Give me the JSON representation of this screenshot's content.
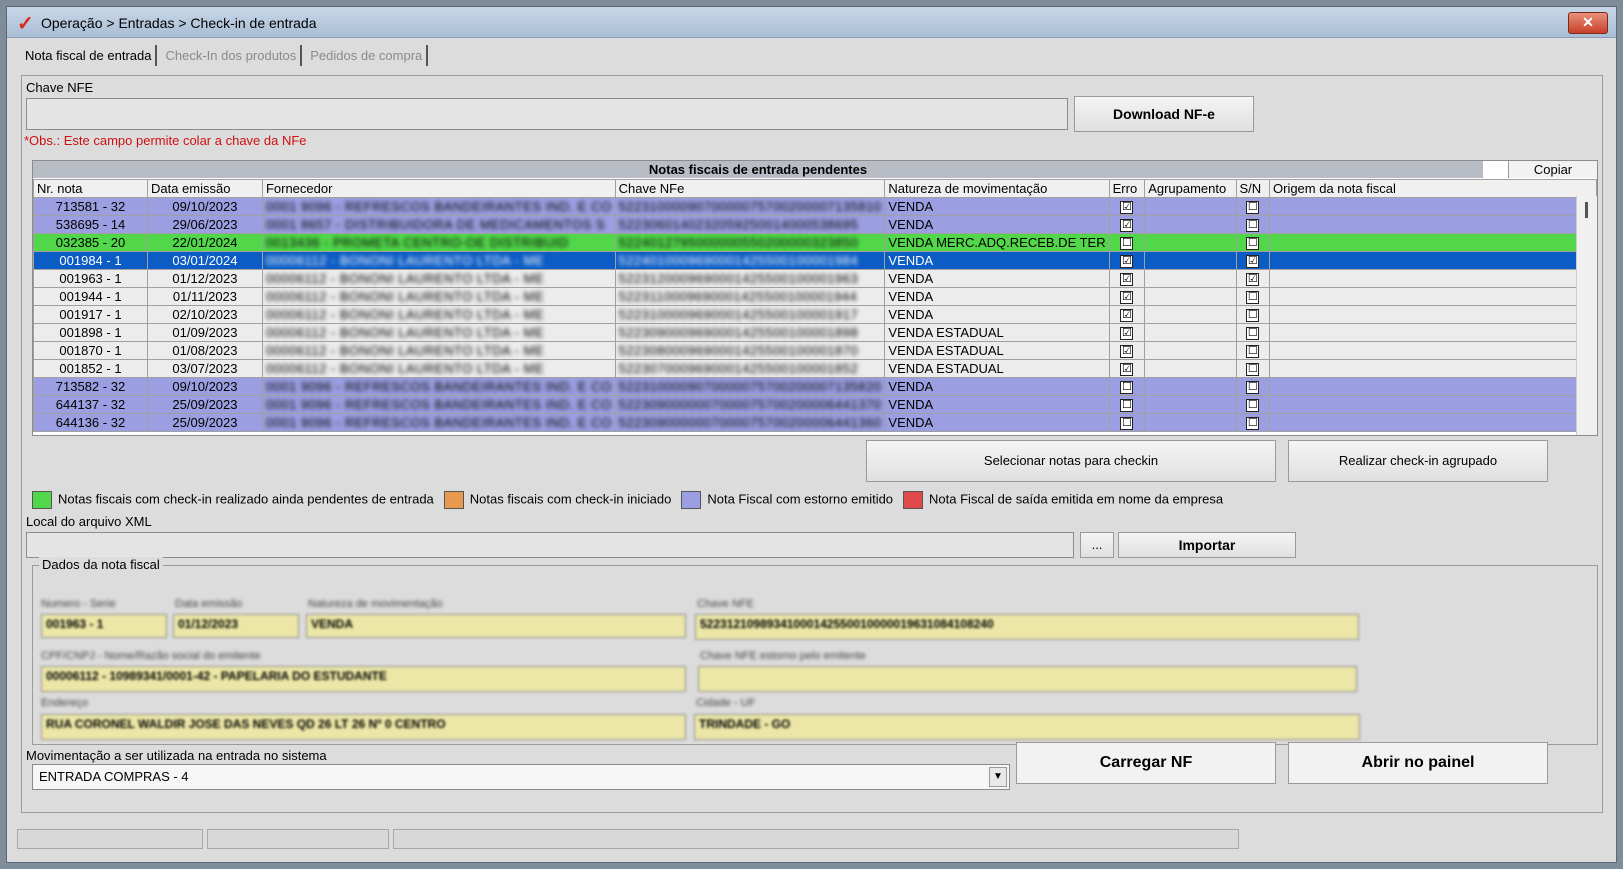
{
  "window": {
    "title": "Operação > Entradas > Check-in de entrada",
    "close_glyph": "✕"
  },
  "tabs": [
    {
      "label": "Nota fiscal de entrada"
    },
    {
      "label": "Check-In dos produtos"
    },
    {
      "label": "Pedidos de compra"
    }
  ],
  "chave": {
    "label": "Chave NFE",
    "value": "",
    "download_label": "Download NF-e",
    "note": "*Obs.: Este campo permite colar a chave da NFe",
    "note_color": "#d01010"
  },
  "grid": {
    "title": "Notas fiscais de entrada pendentes",
    "copy_label": "Copiar",
    "columns": [
      "Nr. nota",
      "Data emissão",
      "Fornecedor",
      "Chave NFe",
      "Natureza de movimentação",
      "Erro",
      "Agrupamento",
      "S/N",
      "Origem da nota fiscal"
    ],
    "rows": [
      {
        "nr": "713581 - 32",
        "data": "09/10/2023",
        "fornecedor": "0001 9096 - REFRESCOS BANDEIRANTES IND. E CO",
        "chave": "5223100009070000075700200007135810",
        "natureza": "VENDA",
        "erro": "☑",
        "agrup": "",
        "sn": "☐",
        "origem": "",
        "style": "lav"
      },
      {
        "nr": "538695 - 14",
        "data": "29/06/2023",
        "fornecedor": "0001 8657 - DISTRIBUIDORA DE MEDICAMENTOS S",
        "chave": "5223060140232059250014000538695",
        "natureza": "VENDA",
        "erro": "☑",
        "agrup": "",
        "sn": "☐",
        "origem": "",
        "style": "lav"
      },
      {
        "nr": "032385 - 20",
        "data": "22/01/2024",
        "fornecedor": "0013436 - PROMETA CENTRO-OE DISTRIBUID",
        "chave": "5224012795000000550200000323850",
        "natureza": "VENDA MERC.ADQ.RECEB.DE TER",
        "erro": "☐",
        "agrup": "",
        "sn": "☐",
        "origem": "",
        "style": "green"
      },
      {
        "nr": "001984 - 1",
        "data": "03/01/2024",
        "fornecedor": "00006112 - BONONI LAURENTO LTDA - ME",
        "chave": "5224010009690001425500100001984",
        "natureza": "VENDA",
        "erro": "☑",
        "agrup": "",
        "sn": "☑",
        "origem": "",
        "style": "sel"
      },
      {
        "nr": "001963 - 1",
        "data": "01/12/2023",
        "fornecedor": "00006112 - BONONI LAURENTO LTDA - ME",
        "chave": "5223120009690001425500100001963",
        "natureza": "VENDA",
        "erro": "☑",
        "agrup": "",
        "sn": "☑",
        "origem": "",
        "style": "white"
      },
      {
        "nr": "001944 - 1",
        "data": "01/11/2023",
        "fornecedor": "00006112 - BONONI LAURENTO LTDA - ME",
        "chave": "5223110009690001425500100001944",
        "natureza": "VENDA",
        "erro": "☑",
        "agrup": "",
        "sn": "☐",
        "origem": "",
        "style": "white"
      },
      {
        "nr": "001917 - 1",
        "data": "02/10/2023",
        "fornecedor": "00006112 - BONONI LAURENTO LTDA - ME",
        "chave": "5223100009690001425500100001917",
        "natureza": "VENDA",
        "erro": "☑",
        "agrup": "",
        "sn": "☐",
        "origem": "",
        "style": "white"
      },
      {
        "nr": "001898 - 1",
        "data": "01/09/2023",
        "fornecedor": "00006112 - BONONI LAURENTO LTDA - ME",
        "chave": "5223090009690001425500100001898",
        "natureza": "VENDA ESTADUAL",
        "erro": "☑",
        "agrup": "",
        "sn": "☐",
        "origem": "",
        "style": "white"
      },
      {
        "nr": "001870 - 1",
        "data": "01/08/2023",
        "fornecedor": "00006112 - BONONI LAURENTO LTDA - ME",
        "chave": "5223080009690001425500100001870",
        "natureza": "VENDA ESTADUAL",
        "erro": "☑",
        "agrup": "",
        "sn": "☐",
        "origem": "",
        "style": "white"
      },
      {
        "nr": "001852 - 1",
        "data": "03/07/2023",
        "fornecedor": "00006112 - BONONI LAURENTO LTDA - ME",
        "chave": "5223070009690001425500100001852",
        "natureza": "VENDA ESTADUAL",
        "erro": "☑",
        "agrup": "",
        "sn": "☐",
        "origem": "",
        "style": "white"
      },
      {
        "nr": "713582 - 32",
        "data": "09/10/2023",
        "fornecedor": "0001 9096 - REFRESCOS BANDEIRANTES IND. E CO",
        "chave": "5223100009070000075700200007135820",
        "natureza": "VENDA",
        "erro": "☐",
        "agrup": "",
        "sn": "☐",
        "origem": "",
        "style": "lav"
      },
      {
        "nr": "644137 - 32",
        "data": "25/09/2023",
        "fornecedor": "0001 9096 - REFRESCOS BANDEIRANTES IND. E CO",
        "chave": "5223090000007000075700200006441370",
        "natureza": "VENDA",
        "erro": "☐",
        "agrup": "",
        "sn": "☐",
        "origem": "",
        "style": "lav"
      },
      {
        "nr": "644136 - 32",
        "data": "25/09/2023",
        "fornecedor": "0001 9096 - REFRESCOS BANDEIRANTES IND. E CO",
        "chave": "5223090000007000075700200006441360",
        "natureza": "VENDA",
        "erro": "☐",
        "agrup": "",
        "sn": "☐",
        "origem": "",
        "style": "lav"
      }
    ]
  },
  "actions": {
    "select_label": "Selecionar notas para checkin",
    "grouped_label": "Realizar check-in agrupado"
  },
  "legend": [
    {
      "color": "#52d64a",
      "label": "Notas fiscais com check-in realizado ainda pendentes de entrada"
    },
    {
      "color": "#e89a50",
      "label": "Notas fiscais com check-in iniciado"
    },
    {
      "color": "#9b9ee0",
      "label": "Nota Fiscal com estorno emitido"
    },
    {
      "color": "#e04a4a",
      "label": "Nota Fiscal de saída emitida em nome da empresa"
    }
  ],
  "xml": {
    "label": "Local do arquivo XML",
    "value": "",
    "browse_label": "...",
    "import_label": "Importar"
  },
  "dados": {
    "title": "Dados da nota fiscal",
    "numero_label": "Numero - Serie",
    "numero": "001963 - 1",
    "data_label": "Data emissão",
    "data": "01/12/2023",
    "natureza_label": "Natureza de movimentação",
    "natureza": "VENDA",
    "chave_label": "Chave NFE",
    "chave": "52231210989341000142550010000019631084108240",
    "cpf_label": "CPF/CNPJ - Nome/Razão social do emitente",
    "cpf": "00006112 - 10989341/0001-42 - PAPELARIA DO ESTUDANTE",
    "estorno_label": "Chave NFE estorno pelo emitente",
    "estorno": "",
    "endereco_label": "Endereço",
    "endereco": "RUA CORONEL WALDIR JOSE DAS NEVES QD 26 LT 26 Nº 0 CENTRO",
    "cidade_label": "Cidade - UF",
    "cidade": "TRINDADE - GO"
  },
  "movimentacao": {
    "label": "Movimentação a ser utilizada na entrada no sistema",
    "value": "ENTRADA COMPRAS - 4"
  },
  "bottom": {
    "carregar_label": "Carregar NF",
    "abrir_label": "Abrir no painel"
  }
}
